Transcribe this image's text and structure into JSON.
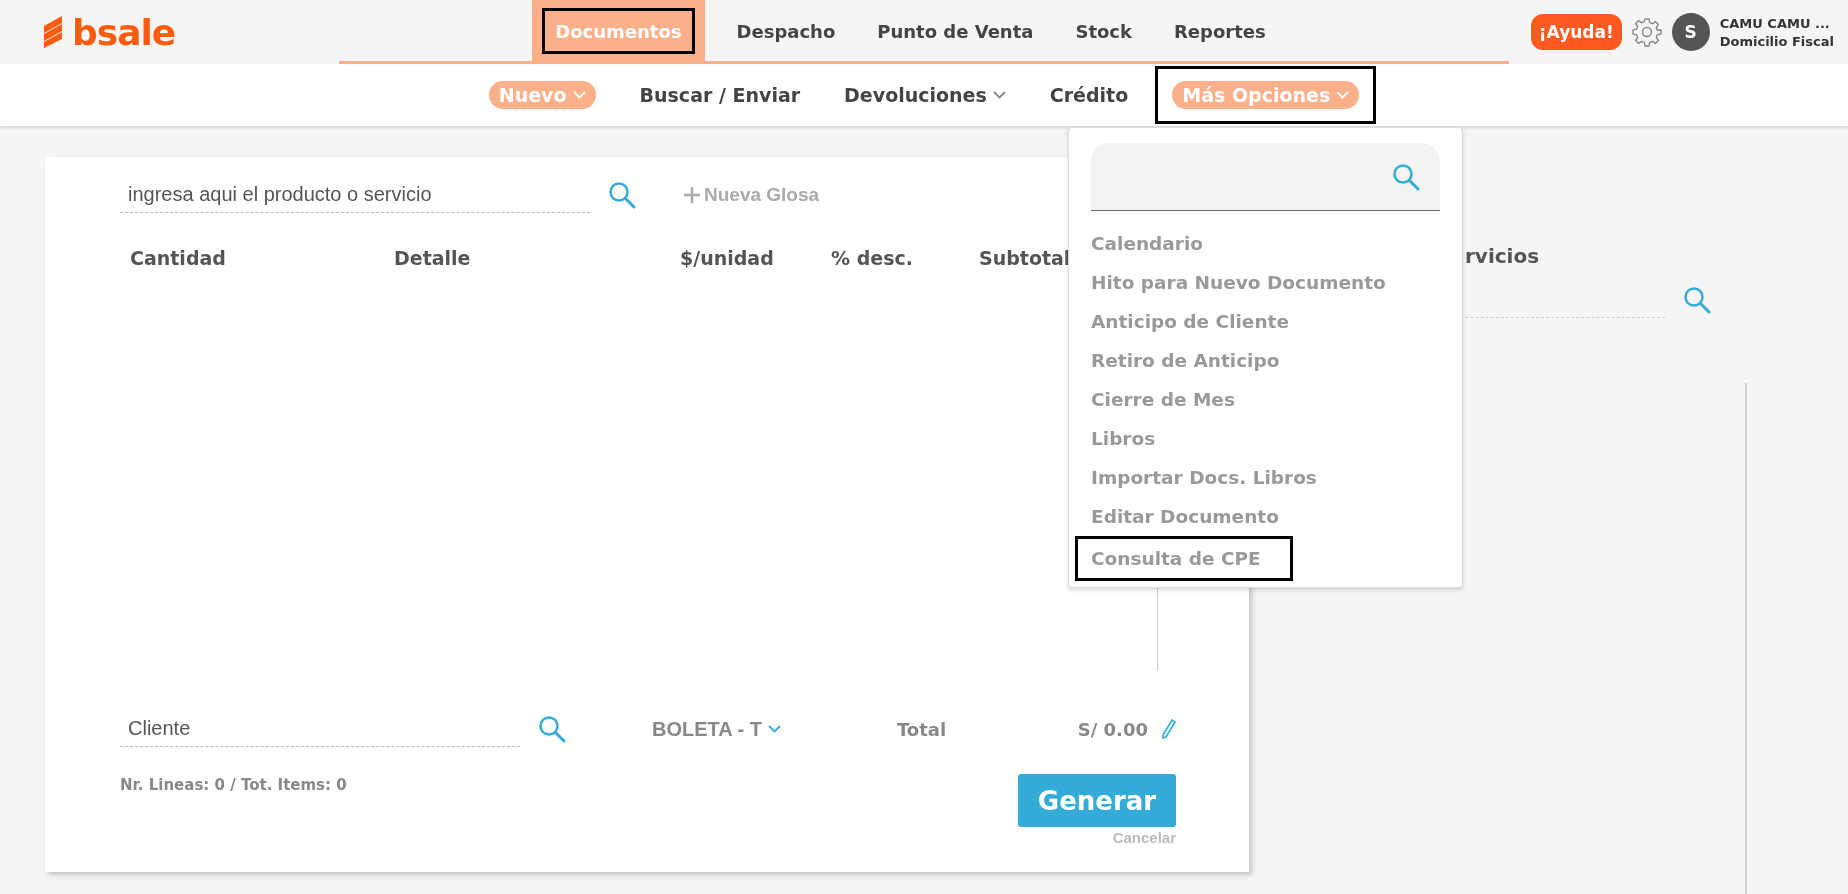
{
  "header": {
    "logo": {
      "text": "bsale"
    },
    "nav": [
      {
        "label": "Documentos",
        "selected": true,
        "highlighted": true
      },
      {
        "label": "Despacho",
        "selected": false,
        "highlighted": false
      },
      {
        "label": "Punto de Venta",
        "selected": false,
        "highlighted": false
      },
      {
        "label": "Stock",
        "selected": false,
        "highlighted": false
      },
      {
        "label": "Reportes",
        "selected": false,
        "highlighted": false
      }
    ],
    "help_button": "¡Ayuda!",
    "user": {
      "initial": "S",
      "name": "CAMU CAMU ...",
      "subtitle": "Domicilio Fiscal"
    }
  },
  "subnav": [
    {
      "label": "Nuevo",
      "selected": true,
      "dropdown": true,
      "highlighted": false
    },
    {
      "label": "Buscar / Enviar",
      "selected": false,
      "dropdown": false,
      "highlighted": false
    },
    {
      "label": "Devoluciones",
      "selected": false,
      "dropdown": true,
      "highlighted": false
    },
    {
      "label": "Crédito",
      "selected": false,
      "dropdown": false,
      "highlighted": false
    },
    {
      "label": "Más Opciones",
      "selected": true,
      "dropdown": true,
      "highlighted": true
    }
  ],
  "document_form": {
    "product_search": {
      "placeholder": "ingresa aqui el producto o servicio"
    },
    "add_line": "Nueva Glosa",
    "columns": [
      "Cantidad",
      "Detalle",
      "$/unidad",
      "% desc.",
      "Subtotal"
    ],
    "client_field": {
      "placeholder": "Cliente"
    },
    "document_type": "BOLETA - T",
    "total_label": "Total",
    "total_value": "S/ 0.00",
    "counts": "Nr. Lineas: 0 / Tot. Items: 0",
    "generate_button": "Generar",
    "cancel_link": "Cancelar"
  },
  "side_panel": {
    "title": "rvicios"
  },
  "dropdown_menu": {
    "items": [
      {
        "label": "Calendario",
        "highlighted": false
      },
      {
        "label": "Hito para Nuevo Documento",
        "highlighted": false
      },
      {
        "label": "Anticipo de Cliente",
        "highlighted": false
      },
      {
        "label": "Retiro de Anticipo",
        "highlighted": false
      },
      {
        "label": "Cierre de Mes",
        "highlighted": false
      },
      {
        "label": "Libros",
        "highlighted": false
      },
      {
        "label": "Importar Docs. Libros",
        "highlighted": false
      },
      {
        "label": "Editar Documento",
        "highlighted": false
      },
      {
        "label": "Consulta de CPE",
        "highlighted": true
      }
    ]
  }
}
